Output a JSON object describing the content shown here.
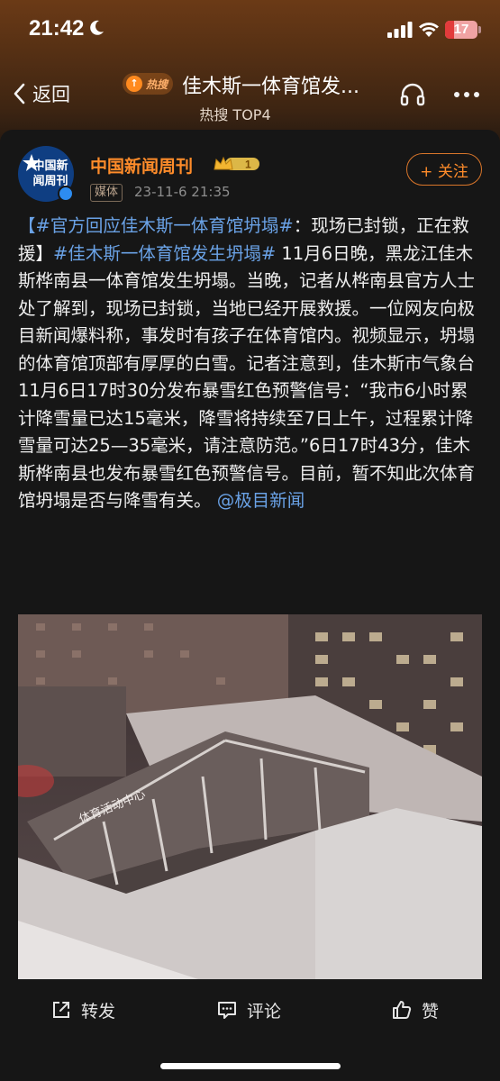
{
  "status_bar": {
    "time": "21:42",
    "battery": "17",
    "colors": {
      "battery_bg": "#f0a3a3",
      "battery_low": "#e23b3b"
    }
  },
  "nav": {
    "back_label": "返回",
    "hot_badge": "热搜",
    "title": "佳木斯一体育馆发...",
    "subtitle": "热搜 TOP4",
    "icons": [
      "chevron-left-icon",
      "headphone-icon",
      "more-icon"
    ]
  },
  "post": {
    "author": "中国新闻周刊",
    "avatar_text": "中国新闻周刊",
    "badge_level": "1",
    "tag": "媒体",
    "time": "23-11-6 21:35",
    "follow_label": "+ 关注",
    "body": {
      "topic1": "【#官方回应佳木斯一体育馆坍塌#",
      "text1": "：现场已封锁，正在救援】",
      "topic2": "#佳木斯一体育馆发生坍塌#",
      "text2": " 11月6日晚，黑龙江佳木斯桦南县一体育馆发生坍塌。当晚，记者从桦南县官方人士处了解到，现场已封锁，当地已经开展救援。一位网友向极目新闻爆料称，事发时有孩子在体育馆内。视频显示，坍塌的体育馆顶部有厚厚的白雪。记者注意到，佳木斯市气象台11月6日17时30分发布暴雪红色预警信号：“我市6小时累计降雪量已达15毫米，降雪将持续至7日上午，过程累计降雪量可达25—35毫米，请注意防范。”6日17时43分，佳木斯桦南县也发布暴雪红色预警信号。目前，暂不知此次体育馆坍塌是否与降雪有关。",
      "mention": "@极目新闻"
    },
    "image_sign_text": "体育活动中心"
  },
  "actions": {
    "repost": "转发",
    "comment": "评论",
    "like": "赞"
  },
  "colors": {
    "accent": "#ff8c2a",
    "link": "#6aa2e6",
    "card_bg": "#161616"
  }
}
